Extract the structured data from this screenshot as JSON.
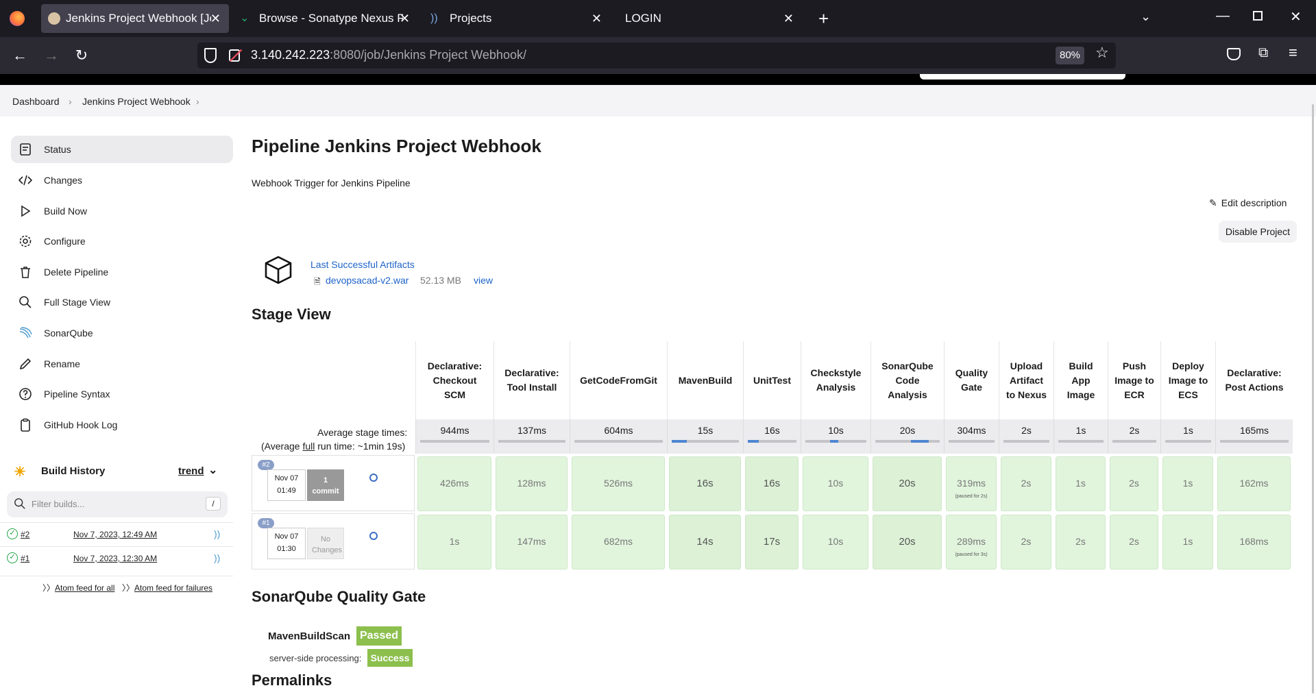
{
  "browser": {
    "tabs": [
      {
        "label": "Jenkins Project Webhook [Jenkins]"
      },
      {
        "label": "Browse - Sonatype Nexus Repository"
      },
      {
        "label": "Projects"
      },
      {
        "label": "LOGIN"
      }
    ],
    "url_host": "3.140.242.223",
    "url_rest": ":8080/job/Jenkins Project Webhook/",
    "zoom": "80%"
  },
  "breadcrumb": [
    "Dashboard",
    "Jenkins Project Webhook"
  ],
  "sidebar": {
    "items": [
      {
        "label": "Status",
        "icon": "status-icon"
      },
      {
        "label": "Changes",
        "icon": "code-icon"
      },
      {
        "label": "Build Now",
        "icon": "play-icon"
      },
      {
        "label": "Configure",
        "icon": "gear-icon"
      },
      {
        "label": "Delete Pipeline",
        "icon": "trash-icon"
      },
      {
        "label": "Full Stage View",
        "icon": "search-icon"
      },
      {
        "label": "SonarQube",
        "icon": "sonarqube-icon"
      },
      {
        "label": "Rename",
        "icon": "pencil-icon"
      },
      {
        "label": "Pipeline Syntax",
        "icon": "help-icon"
      },
      {
        "label": "GitHub Hook Log",
        "icon": "clipboard-icon"
      }
    ]
  },
  "build_history": {
    "title": "Build History",
    "trend": "trend",
    "filter_placeholder": "Filter builds...",
    "filter_shortcut": "/",
    "builds": [
      {
        "num": "#2",
        "date": "Nov 7, 2023, 12:49 AM"
      },
      {
        "num": "#1",
        "date": "Nov 7, 2023, 12:30 AM"
      }
    ],
    "atom_all": "Atom feed for all",
    "atom_failures": "Atom feed for failures"
  },
  "main": {
    "title": "Pipeline Jenkins Project Webhook",
    "description": "Webhook Trigger for Jenkins Pipeline",
    "edit_description": "Edit description",
    "disable_project": "Disable Project",
    "artifacts_title": "Last Successful Artifacts",
    "artifact_file": "devopsacad-v2.war",
    "artifact_size": "52.13 MB",
    "artifact_view": "view"
  },
  "stage_view": {
    "title": "Stage View",
    "avg_label": "Average stage times:",
    "avg_run_prefix": "(Average ",
    "avg_run_link": "full",
    "avg_run_suffix": " run time: ~1min 19s)",
    "stages": [
      {
        "name": "Declarative: Checkout SCM",
        "avg": "944ms",
        "avgfrac": 0.0
      },
      {
        "name": "Declarative: Tool Install",
        "avg": "137ms",
        "avgfrac": 0.0
      },
      {
        "name": "GetCodeFromGit",
        "avg": "604ms",
        "avgfrac": 0.0
      },
      {
        "name": "MavenBuild",
        "avg": "15s",
        "avgfrac": 0.22
      },
      {
        "name": "UnitTest",
        "avg": "16s",
        "avgfrac": 0.22
      },
      {
        "name": "Checkstyle Analysis",
        "avg": "10s",
        "avgfrac": 0.14
      },
      {
        "name": "SonarQube Code Analysis",
        "avg": "20s",
        "avgfrac": 0.28
      },
      {
        "name": "Quality Gate",
        "avg": "304ms",
        "avgfrac": 0.0
      },
      {
        "name": "Upload Artifact to Nexus",
        "avg": "2s",
        "avgfrac": 0.0
      },
      {
        "name": "Build App Image",
        "avg": "1s",
        "avgfrac": 0.0
      },
      {
        "name": "Push Image to ECR",
        "avg": "2s",
        "avgfrac": 0.0
      },
      {
        "name": "Deploy Image to ECS",
        "avg": "1s",
        "avgfrac": 0.0
      },
      {
        "name": "Declarative: Post Actions",
        "avg": "165ms",
        "avgfrac": 0.0
      }
    ],
    "runs": [
      {
        "badge": "#2",
        "month_day": "Nov 07",
        "time": "01:49",
        "changes": "1 commit",
        "times": [
          "426ms",
          "128ms",
          "526ms",
          "16s",
          "16s",
          "10s",
          "20s",
          "319ms",
          "2s",
          "1s",
          "2s",
          "1s",
          "162ms"
        ],
        "pauses": [
          "",
          "",
          "",
          "",
          "",
          "",
          "",
          "(paused for 2s)",
          "",
          "",
          "",
          "",
          ""
        ]
      },
      {
        "badge": "#1",
        "month_day": "Nov 07",
        "time": "01:30",
        "changes": "No Changes",
        "times": [
          "1s",
          "147ms",
          "682ms",
          "14s",
          "17s",
          "10s",
          "20s",
          "289ms",
          "2s",
          "2s",
          "2s",
          "1s",
          "168ms"
        ],
        "pauses": [
          "",
          "",
          "",
          "",
          "",
          "",
          "",
          "(paused for 3s)",
          "",
          "",
          "",
          "",
          ""
        ]
      }
    ]
  },
  "quality_gate": {
    "title": "SonarQube Quality Gate",
    "project": "MavenBuildScan",
    "status": "Passed",
    "processing_label": "server-side processing:",
    "processing_status": "Success",
    "status_color": "#8cbf4d"
  },
  "permalinks_title": "Permalinks"
}
